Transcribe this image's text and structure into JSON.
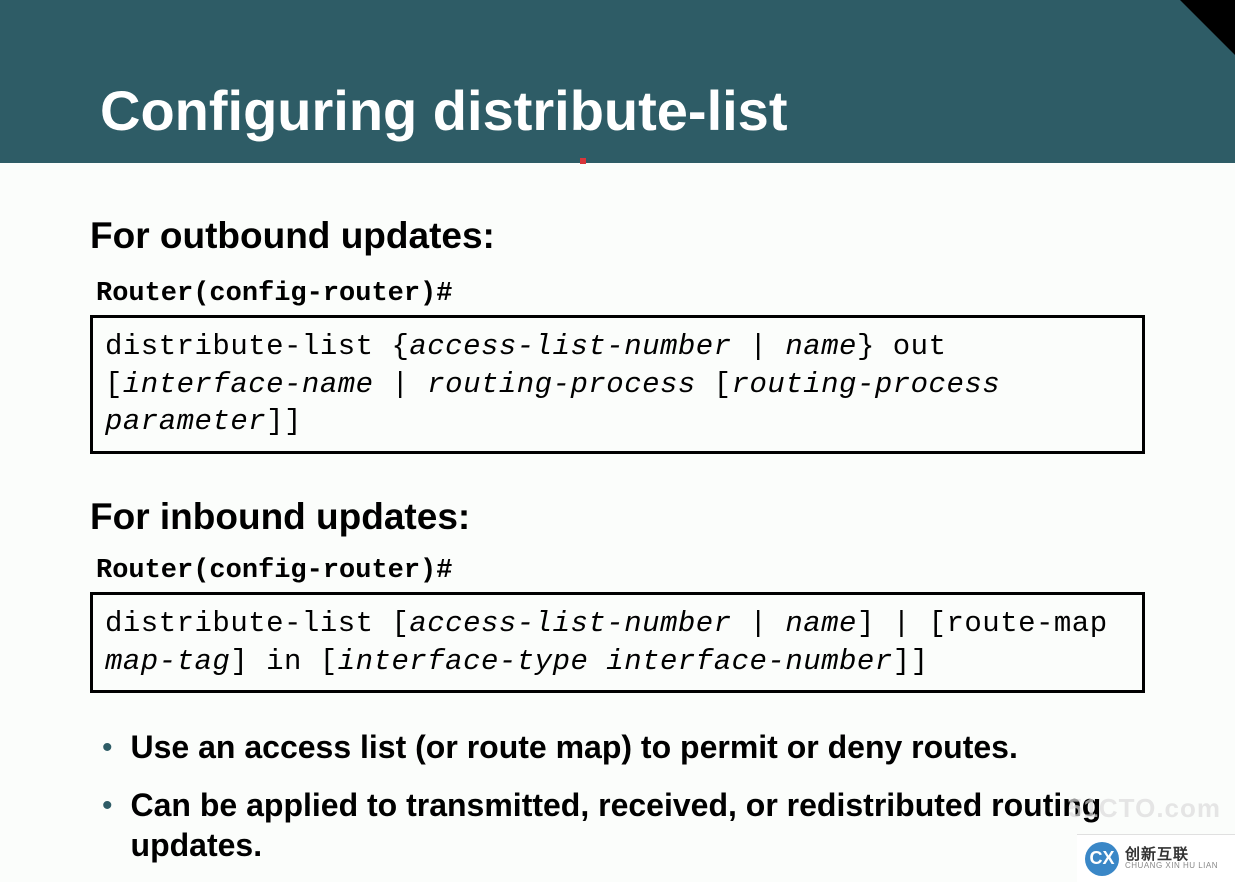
{
  "header": {
    "title": "Configuring distribute-list"
  },
  "sections": {
    "outbound": {
      "heading": "For outbound updates:",
      "prompt": "Router(config-router)#",
      "syntax": {
        "p1": "distribute-list {",
        "p2": "access-list-number",
        "p3": " | ",
        "p4": "name",
        "p5": "} out [",
        "p6": "interface-name",
        "p7": "  | ",
        "p8": "routing-process",
        "p9": " [",
        "p10": "routing-process parameter",
        "p11": "]]"
      }
    },
    "inbound": {
      "heading": "For inbound updates:",
      "prompt": "Router(config-router)#",
      "syntax": {
        "p1": "distribute-list [",
        "p2": "access-list-number",
        "p3": " | ",
        "p4": "name",
        "p5": "] | [route-map ",
        "p6": "map-tag",
        "p7": "] in [",
        "p8": "interface-type interface-number",
        "p9": "]]"
      }
    }
  },
  "bullets": {
    "b1": "Use an access list (or route map) to permit or deny routes.",
    "b2": "Can be applied to transmitted, received, or redistributed routing updates."
  },
  "watermark": "51CTO.com",
  "logo": {
    "icon": "CX",
    "cn": "创新互联",
    "py": "CHUANG XIN HU LIAN"
  }
}
